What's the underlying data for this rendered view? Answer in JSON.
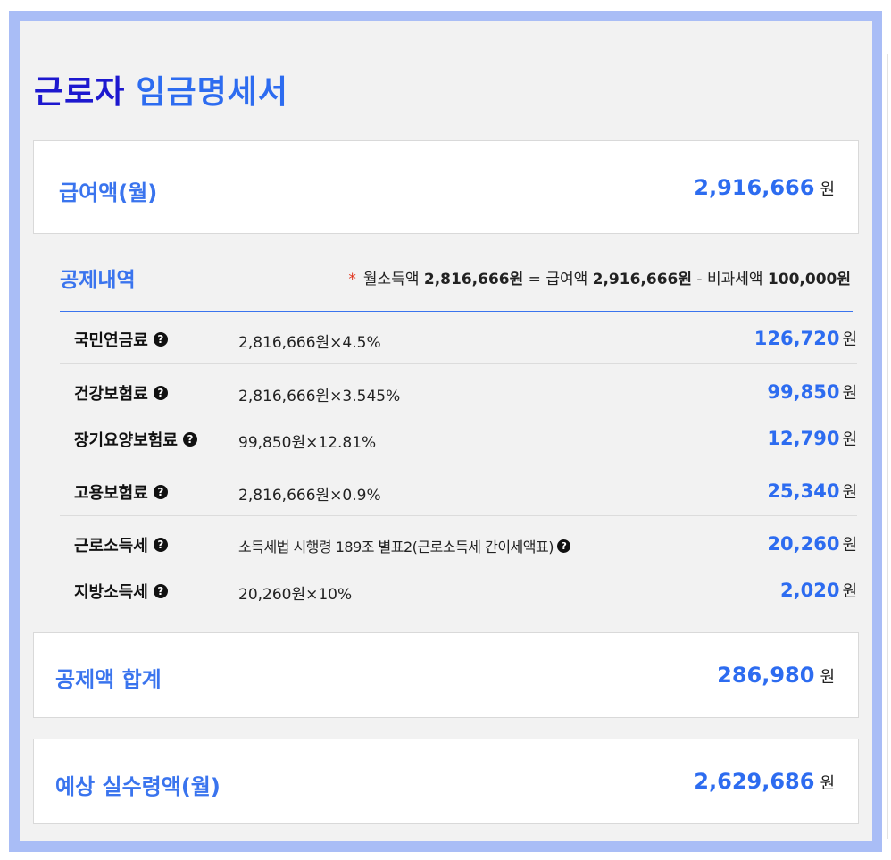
{
  "title": {
    "part1": "근로자",
    "part2": "임금명세서"
  },
  "salary": {
    "label": "급여액(월)",
    "amount": "2,916,666",
    "unit": "원"
  },
  "deductions": {
    "title": "공제내역",
    "formula": {
      "star": "*",
      "prefix": "월소득액",
      "income": "2,816,666원",
      "eq": "=",
      "salary_label": "급여액",
      "salary": "2,916,666원",
      "minus": "-",
      "nontax_label": "비과세액",
      "nontax": "100,000원"
    },
    "items": [
      {
        "name": "국민연금료",
        "help": "?",
        "calc": "2,816,666원×4.5%",
        "calc_help": "",
        "amount": "126,720",
        "unit": "원"
      },
      {
        "name": "건강보험료",
        "help": "?",
        "calc": "2,816,666원×3.545%",
        "calc_help": "",
        "amount": "99,850",
        "unit": "원"
      },
      {
        "name": "장기요양보험료",
        "help": "?",
        "calc": "99,850원×12.81%",
        "calc_help": "",
        "amount": "12,790",
        "unit": "원"
      },
      {
        "name": "고용보험료",
        "help": "?",
        "calc": "2,816,666원×0.9%",
        "calc_help": "",
        "amount": "25,340",
        "unit": "원"
      },
      {
        "name": "근로소득세",
        "help": "?",
        "calc": "소득세법 시행령 189조 별표2(근로소득세 간이세액표)",
        "calc_help": "?",
        "amount": "20,260",
        "unit": "원"
      },
      {
        "name": "지방소득세",
        "help": "?",
        "calc": "20,260원×10%",
        "calc_help": "",
        "amount": "2,020",
        "unit": "원"
      }
    ]
  },
  "total": {
    "label": "공제액 합계",
    "amount": "286,980",
    "unit": "원"
  },
  "net": {
    "label": "예상 실수령액(월)",
    "amount": "2,629,686",
    "unit": "원"
  },
  "colors": {
    "frame": "#a9bdf6",
    "accent": "#2d6cf0",
    "title_dark": "#1d18cf",
    "star": "#e0341d"
  }
}
